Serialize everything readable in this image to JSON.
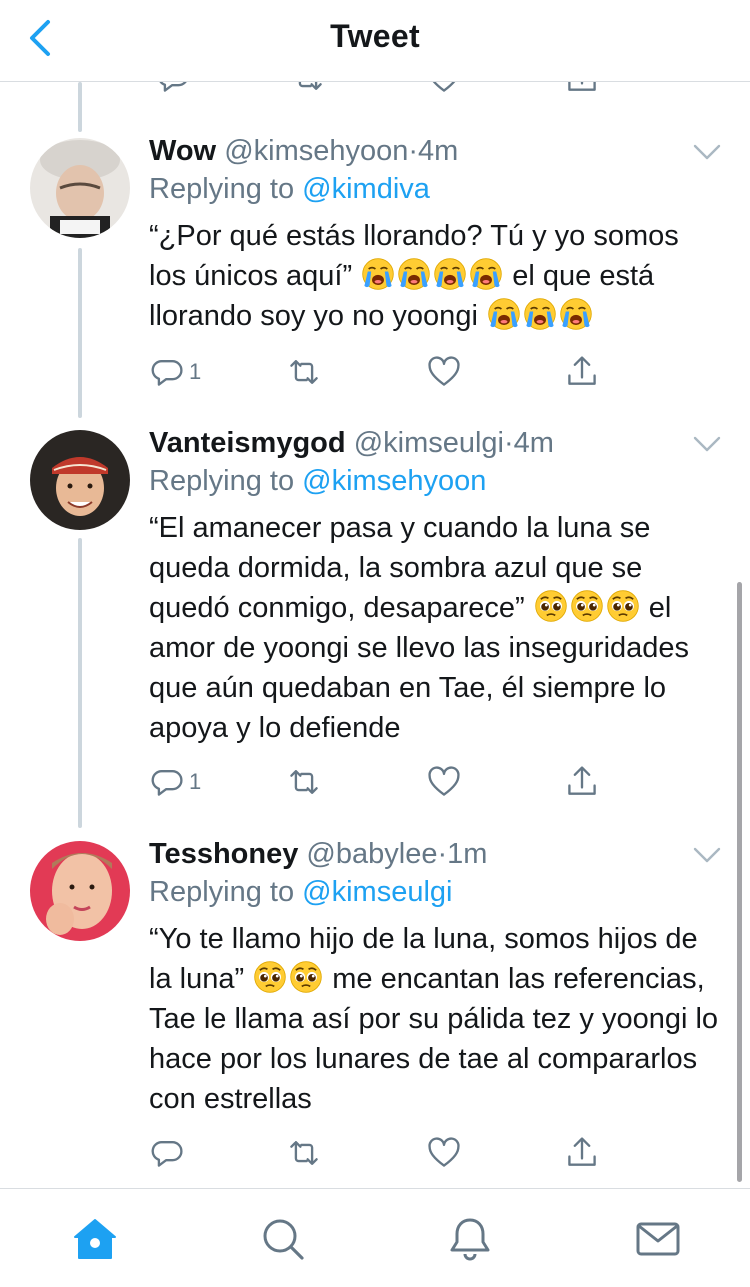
{
  "header": {
    "title": "Tweet"
  },
  "tweets": [
    {
      "name": "Wow",
      "handle": "@kimsehyoon",
      "sep": "·",
      "time": "4m",
      "replying_prefix": "Replying to",
      "replying_to": "@kimdiva",
      "text_a": "“¿Por qué estás llorando? Tú y yo somos los únicos aquí”",
      "text_b": "el que está llorando soy yo no yoongi",
      "reply_count": "1"
    },
    {
      "name": "Vanteismygod",
      "handle": "@kimseulgi",
      "sep": "·",
      "time": "4m",
      "replying_prefix": "Replying to",
      "replying_to": "@kimsehyoon",
      "text_a": "“El amanecer pasa y cuando la luna se queda dormida, la sombra azul que se quedó conmigo, desaparece”",
      "text_b": "el amor de yoongi se llevo las inseguridades que aún quedaban en Tae, él siempre lo apoya y lo defiende",
      "reply_count": "1"
    },
    {
      "name": "Tesshoney",
      "handle": "@babylee",
      "sep": "·",
      "time": "1m",
      "replying_prefix": "Replying to",
      "replying_to": "@kimseulgi",
      "text_a": "“Yo te llamo hijo de la luna, somos hijos de la luna”",
      "text_b": "me encantan las referencias, Tae le llama así por su pálida tez y yoongi lo hace por los lunares de tae al compararlos con estrellas",
      "reply_count": ""
    }
  ],
  "icons": {
    "back": "chevron-left-icon",
    "reply": "reply-icon",
    "retweet": "retweet-icon",
    "like": "heart-icon",
    "share": "share-icon",
    "tab_home": "home-icon",
    "tab_search": "search-icon",
    "tab_notifications": "bell-icon",
    "tab_messages": "mail-icon"
  },
  "colors": {
    "accent": "#1da1f2",
    "secondary_text": "#657786",
    "thread_line": "#ccd6dd"
  }
}
